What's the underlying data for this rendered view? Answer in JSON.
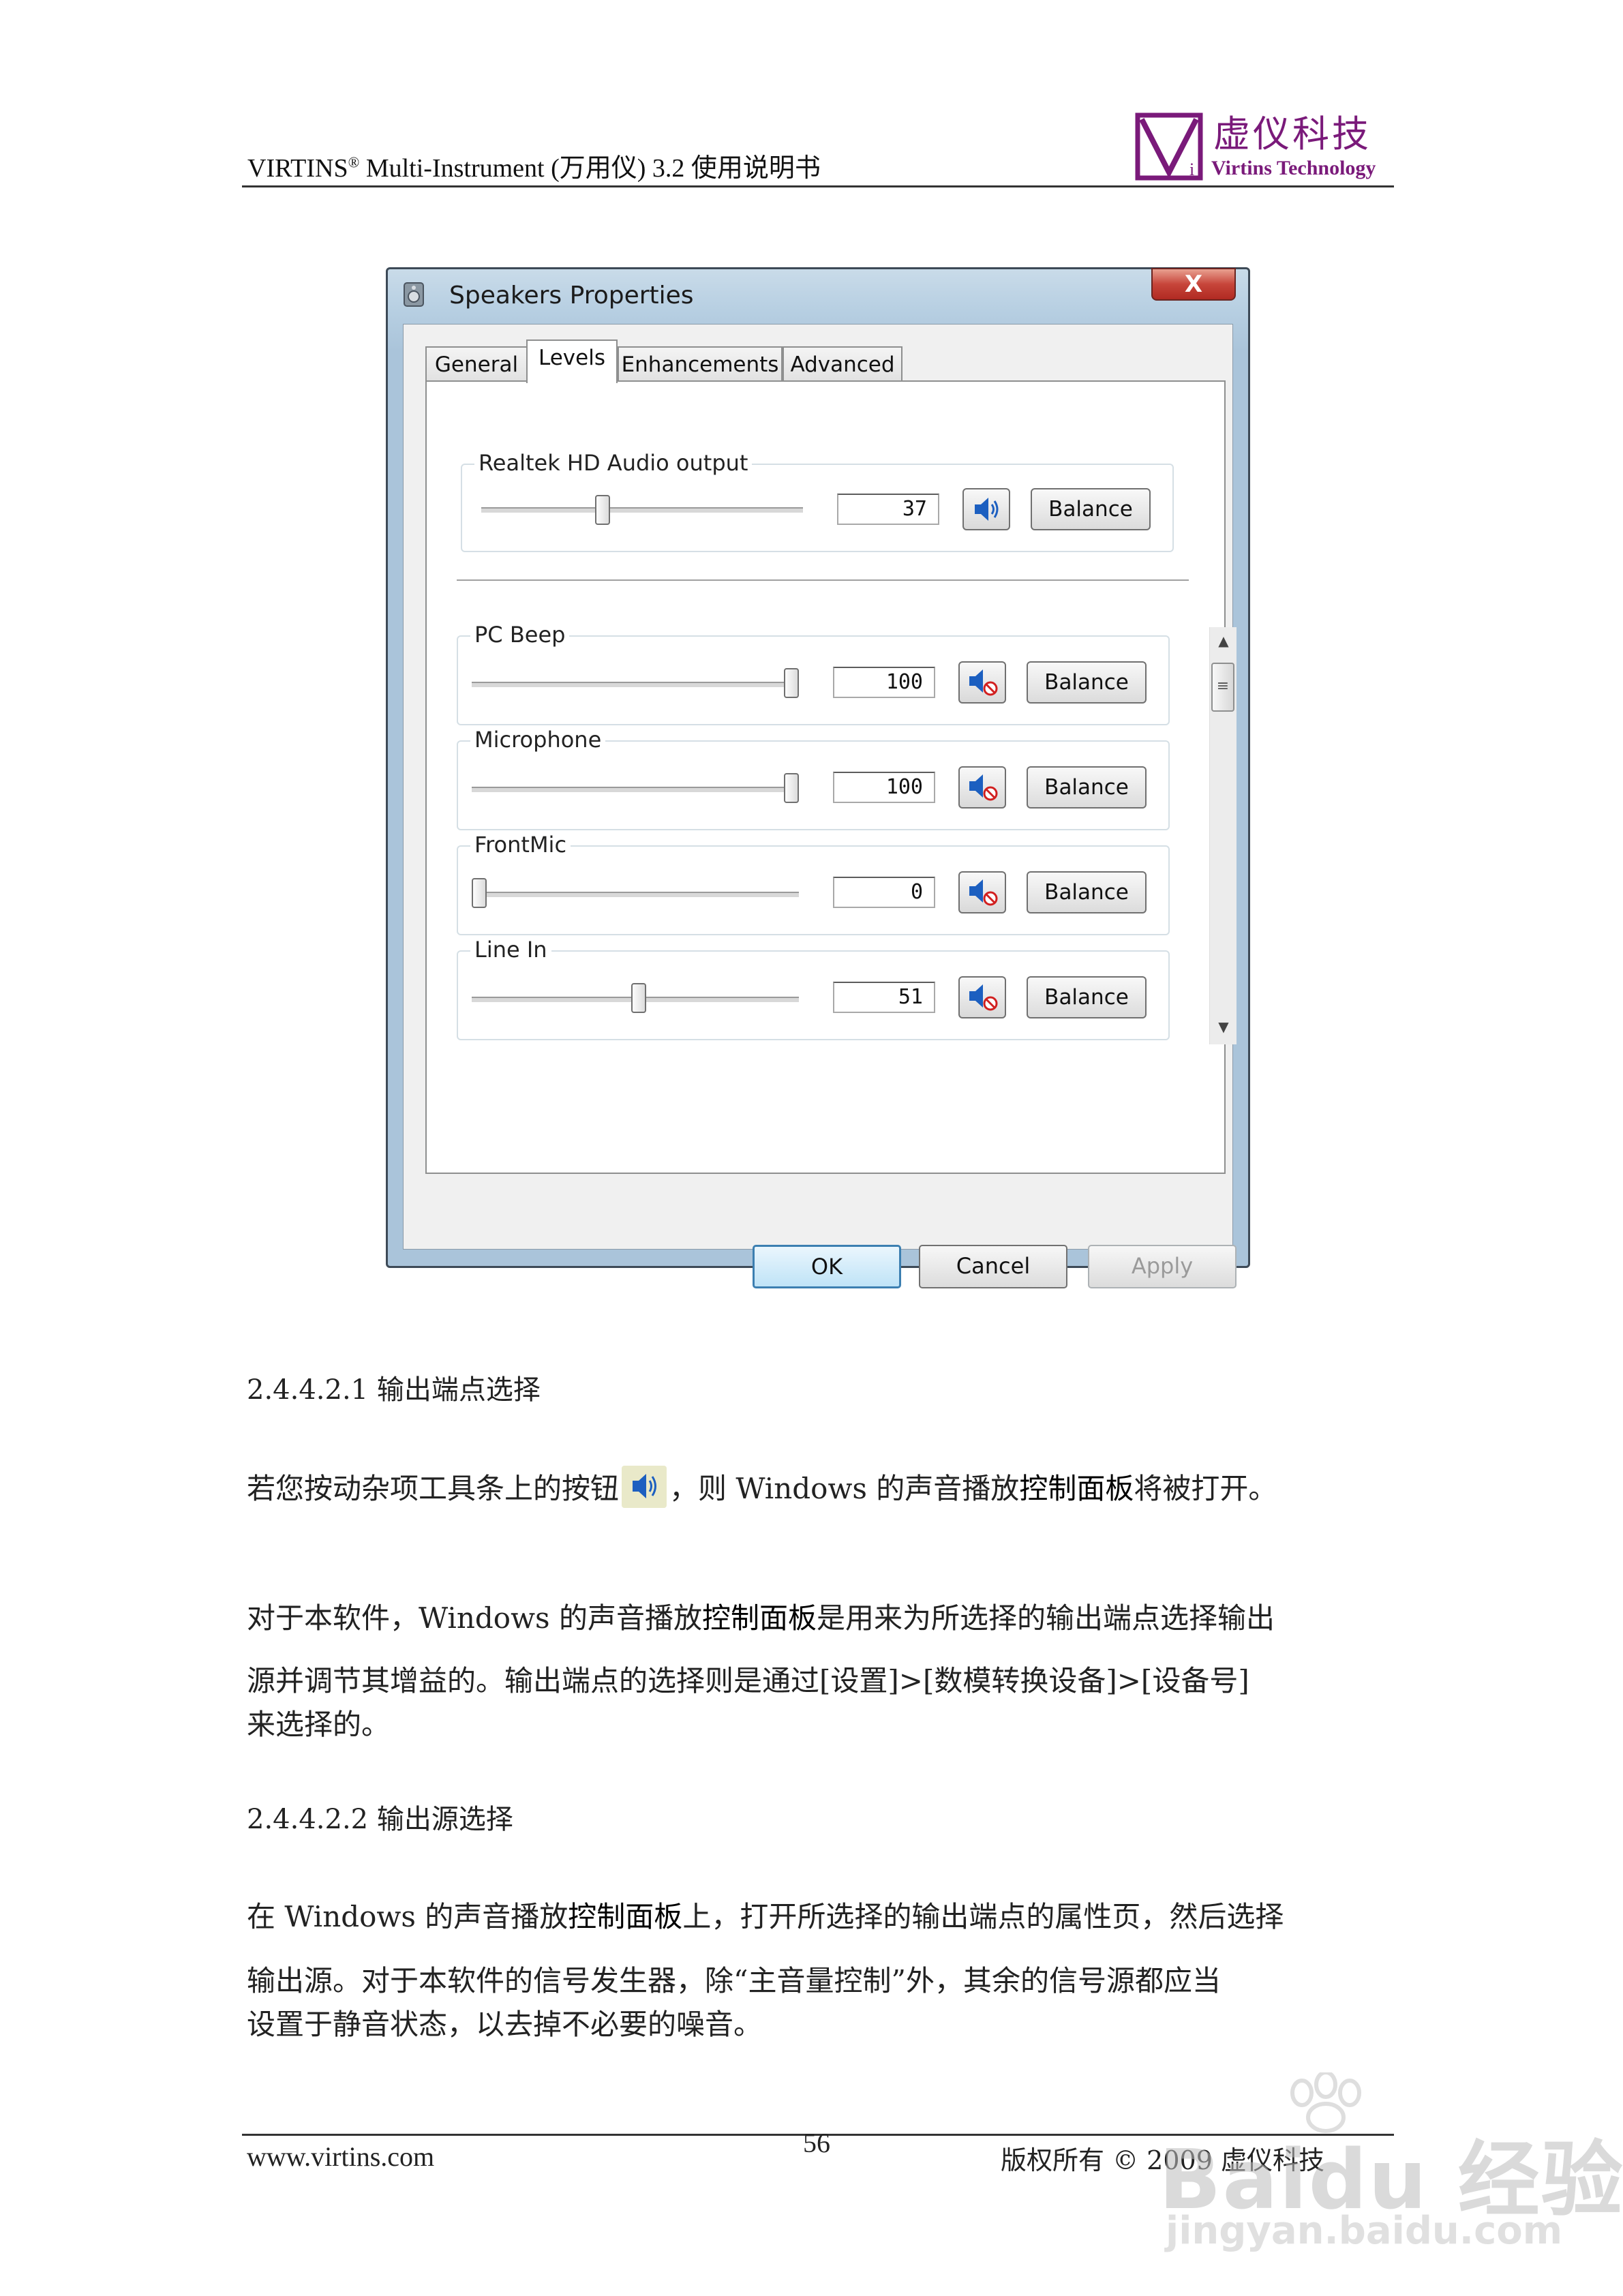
{
  "header": {
    "title_prefix": "VIRTINS",
    "title_reg": "®",
    "title_suffix": " Multi-Instrument (万用仪) 3.2 使用说明书",
    "logo_cn": "虚仪科技",
    "logo_en": "Virtins Technology",
    "brand_color": "#7a1a7a"
  },
  "dialog": {
    "title": "Speakers Properties",
    "close_label": "X",
    "tabs": [
      {
        "label": "General"
      },
      {
        "label": "Levels",
        "active": true
      },
      {
        "label": "Enhancements"
      },
      {
        "label": "Advanced"
      }
    ],
    "main_output": {
      "label": "Realtek HD Audio output",
      "value": "37",
      "level": 0.37,
      "muted": false,
      "balance_label": "Balance"
    },
    "sources": [
      {
        "label": "PC Beep",
        "value": "100",
        "level": 1.0,
        "muted": true,
        "balance_label": "Balance"
      },
      {
        "label": "Microphone",
        "value": "100",
        "level": 1.0,
        "muted": true,
        "balance_label": "Balance"
      },
      {
        "label": "FrontMic",
        "value": "0",
        "level": 0.0,
        "muted": true,
        "balance_label": "Balance"
      },
      {
        "label": "Line In",
        "value": "51",
        "level": 0.51,
        "muted": true,
        "balance_label": "Balance"
      }
    ],
    "buttons": {
      "ok": "OK",
      "cancel": "Cancel",
      "apply": "Apply"
    }
  },
  "body": {
    "heading1": "2.4.4.2.1 输出端点选择",
    "p1_before": "若您按动杂项工具条上的按钮",
    "p1_mid": "，则 Windows 的声音播放",
    "p1_ui": "控制面板",
    "p1_after": "将被打开。",
    "p2_line1_before": "对于本软件，Windows 的声音播放",
    "p2_line1_ui": "控制面板",
    "p2_line1_after": "是用来为所选择的输出端点选择输出",
    "p2_line2": "源并调节其增益的。输出端点的选择则是通过[设置]>[数模转换设备]>[设备号]",
    "p2_line3": "来选择的。",
    "heading2": "2.4.4.2.2 输出源选择",
    "p3_line1_before": "在 Windows 的声音播放",
    "p3_line1_ui": "控制面板",
    "p3_line1_after": "上，打开所选择的输出端点的属性页，然后选择",
    "p3_line2": "输出源。对于本软件的信号发生器，除“主音量控制”外，其余的信号源都应当",
    "p3_line3": "设置于静音状态，以去掉不必要的噪音。"
  },
  "footer": {
    "url": "www.virtins.com",
    "page": "56",
    "copyright": "版权所有 © 2009 虚仪科技"
  },
  "watermark": {
    "main": "Baidu 经验",
    "sub": "jingyan.baidu.com"
  }
}
